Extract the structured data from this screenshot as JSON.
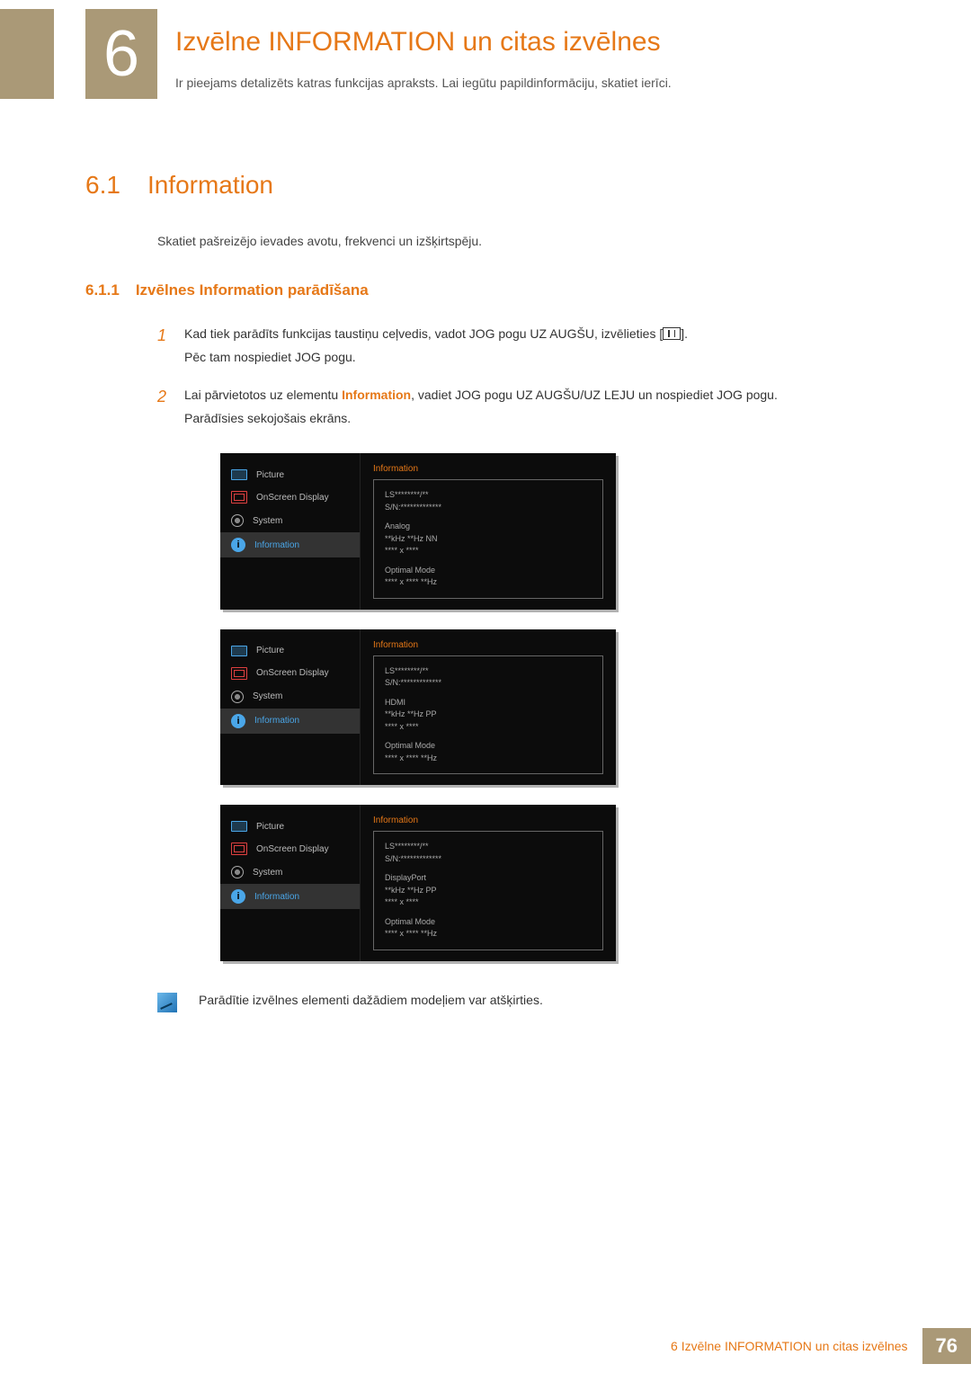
{
  "chapter": {
    "number": "6",
    "title": "Izvēlne INFORMATION un citas izvēlnes",
    "desc": "Ir pieejams detalizēts katras funkcijas apraksts. Lai iegūtu papildinformāciju, skatiet ierīci."
  },
  "section": {
    "number": "6.1",
    "title": "Information",
    "intro": "Skatiet pašreizējo ievades avotu, frekvenci un izšķirtspēju."
  },
  "subsection": {
    "number": "6.1.1",
    "title": "Izvēlnes Information parādīšana"
  },
  "steps": {
    "s1_num": "1",
    "s1_a": "Kad tiek parādīts funkcijas taustiņu ceļvedis, vadot JOG pogu UZ AUGŠU, izvēlieties [",
    "s1_b": "].",
    "s1_c": "Pēc tam nospiediet JOG pogu.",
    "s2_num": "2",
    "s2_a": "Lai pārvietotos uz elementu ",
    "s2_hl": "Information",
    "s2_b": ", vadiet JOG pogu UZ AUGŠU/UZ LEJU un nospiediet JOG pogu.",
    "s2_c": "Parādīsies sekojošais ekrāns."
  },
  "osd_menu": {
    "picture": "Picture",
    "onscreen": "OnScreen Display",
    "system": "System",
    "information": "Information"
  },
  "osd_panels": [
    {
      "header": "Information",
      "line_model": "LS********/**",
      "line_sn": "S/N:*************",
      "line_source": "Analog",
      "line_freq": "**kHz **Hz NN",
      "line_res": "**** x ****",
      "line_opt1": "Optimal Mode",
      "line_opt2": "**** x **** **Hz"
    },
    {
      "header": "Information",
      "line_model": "LS********/**",
      "line_sn": "S/N:*************",
      "line_source": "HDMI",
      "line_freq": "**kHz **Hz PP",
      "line_res": "**** x ****",
      "line_opt1": "Optimal Mode",
      "line_opt2": "**** x **** **Hz"
    },
    {
      "header": "Information",
      "line_model": "LS********/**",
      "line_sn": "S/N:*************",
      "line_source": "DisplayPort",
      "line_freq": "**kHz **Hz PP",
      "line_res": "**** x ****",
      "line_opt1": "Optimal Mode",
      "line_opt2": "**** x **** **Hz"
    }
  ],
  "note": "Parādītie izvēlnes elementi dažādiem modeļiem var atšķirties.",
  "footer": {
    "text": "6 Izvēlne INFORMATION un citas izvēlnes",
    "page": "76"
  }
}
